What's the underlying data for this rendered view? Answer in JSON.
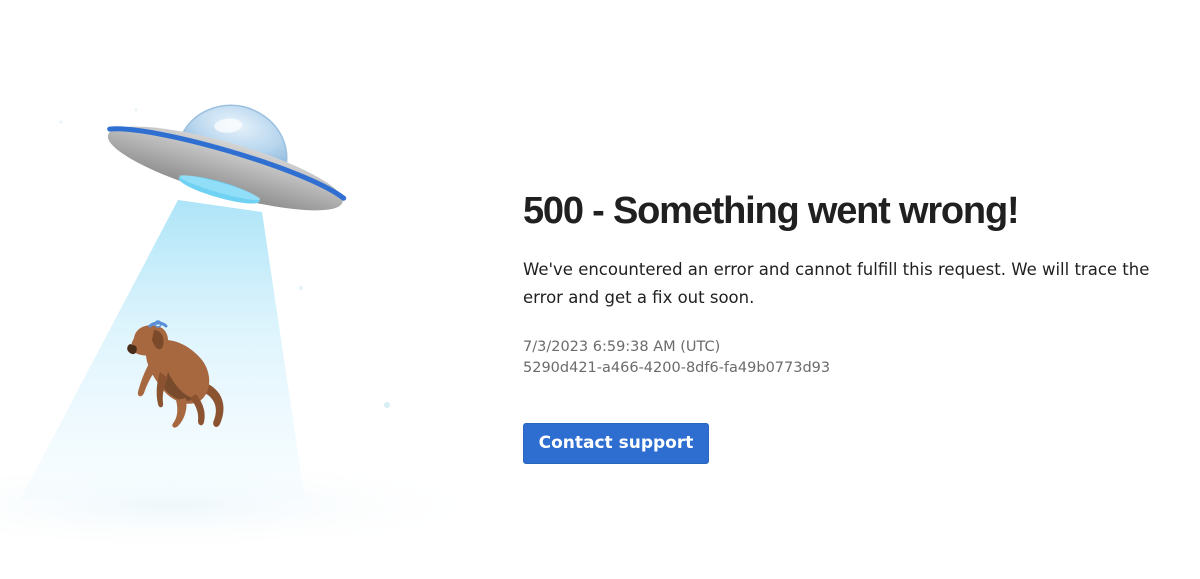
{
  "error": {
    "title": "500 - Something went wrong!",
    "message": "We've encountered an error and cannot fulfill this request. We will trace the error and get a fix out soon.",
    "timestamp": "7/3/2023 6:59:38 AM (UTC)",
    "request_id": "5290d421-a466-4200-8df6-fa49b0773d93"
  },
  "actions": {
    "contact_support_label": "Contact support"
  },
  "colors": {
    "button_bg": "#2d6ed0",
    "ufo_stripe": "#2f6fd1",
    "beam": "#d6f0fb",
    "dog": "#a8683f"
  },
  "illustration": {
    "icon": "ufo-abducting-dog"
  }
}
